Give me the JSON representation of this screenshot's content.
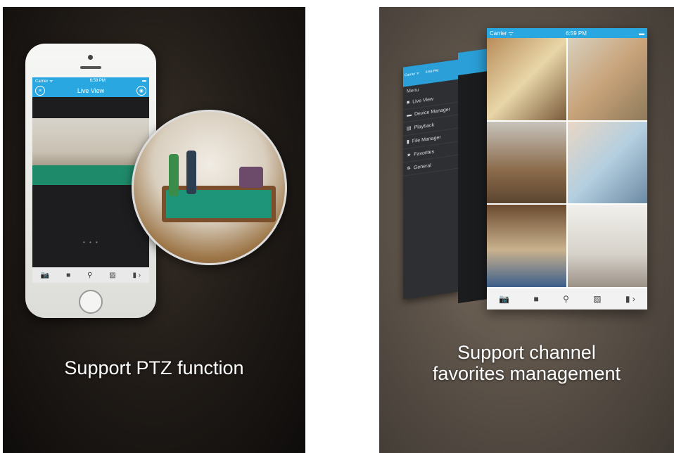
{
  "left_panel": {
    "caption": "Support PTZ function",
    "phone": {
      "status_carrier": "Carrier ᯤ",
      "status_time": "6:59 PM",
      "nav_title": "Live View",
      "menu_icon": "menu-icon",
      "cam_icon": "camera-switch-icon",
      "page_dots": "• • •",
      "toolbar": [
        {
          "icon": "snapshot-icon",
          "glyph": "📷"
        },
        {
          "icon": "record-icon",
          "glyph": "■"
        },
        {
          "icon": "ptz-icon",
          "glyph": "⚲"
        },
        {
          "icon": "image-quality-icon",
          "glyph": "▨"
        },
        {
          "icon": "more-icon",
          "glyph": "▮ ›"
        }
      ]
    }
  },
  "right_panel": {
    "caption_line1": "Support channel",
    "caption_line2": "favorites management",
    "menu": {
      "status_carrier": "Carrier ᯤ",
      "status_time": "6:59 PM",
      "title": "Menu",
      "items": [
        {
          "label": "Live View",
          "icon": "video-icon",
          "glyph": "■"
        },
        {
          "label": "Device Manager",
          "icon": "device-icon",
          "glyph": "▬"
        },
        {
          "label": "Playback",
          "icon": "playback-icon",
          "glyph": "▤"
        },
        {
          "label": "File Manager",
          "icon": "file-icon",
          "glyph": "▮"
        },
        {
          "label": "Favorites",
          "icon": "star-icon",
          "glyph": "★"
        },
        {
          "label": "General",
          "icon": "gear-icon",
          "glyph": "✲"
        }
      ]
    },
    "grid_phone": {
      "status_carrier": "Carrier ᯤ",
      "status_time": "6:59 PM",
      "toolbar": [
        {
          "icon": "snapshot-icon",
          "glyph": "📷"
        },
        {
          "icon": "record-icon",
          "glyph": "■"
        },
        {
          "icon": "ptz-icon",
          "glyph": "⚲"
        },
        {
          "icon": "image-quality-icon",
          "glyph": "▨"
        },
        {
          "icon": "more-icon",
          "glyph": "▮ ›"
        }
      ]
    }
  }
}
